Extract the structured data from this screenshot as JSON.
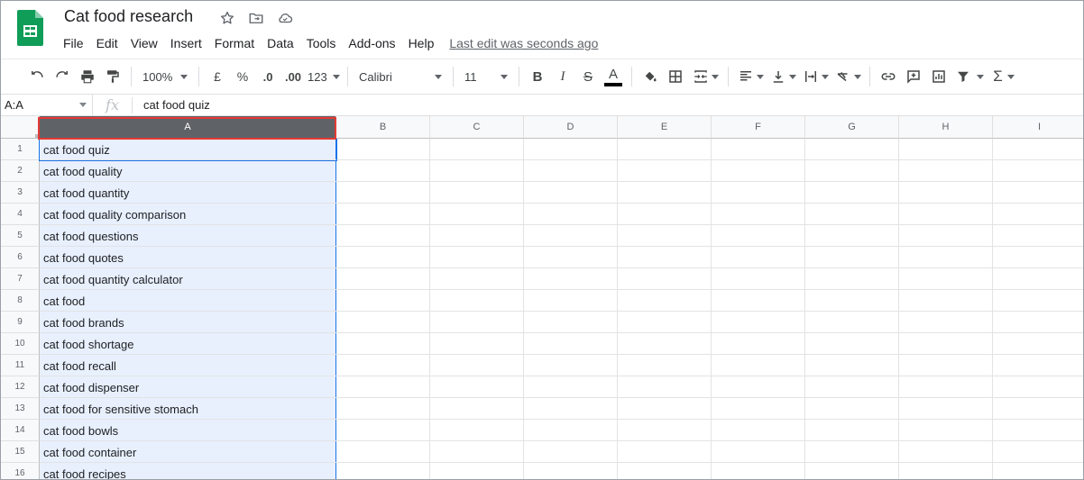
{
  "app": {
    "title": "Cat food research",
    "icons": [
      "sheets-logo-icon",
      "star-icon",
      "move-folder-icon",
      "cloud-status-icon"
    ],
    "brand_color": "#0f9d58"
  },
  "menu": {
    "items": [
      "File",
      "Edit",
      "View",
      "Insert",
      "Format",
      "Data",
      "Tools",
      "Add-ons",
      "Help"
    ],
    "last_edit": "Last edit was seconds ago"
  },
  "toolbar": {
    "zoom": "100%",
    "currency": "£",
    "percent": "%",
    "decrease_decimal": ".0",
    "increase_decimal": ".00",
    "format_more": "123",
    "font": "Calibri",
    "font_size": "11",
    "bold": "B",
    "italic": "I",
    "strikethrough": "S",
    "text_color_label": "A",
    "sum": "Σ"
  },
  "formula_bar": {
    "name_box": "A:A",
    "fx": "fx",
    "value": "cat food quiz"
  },
  "grid": {
    "columns": [
      "A",
      "B",
      "C",
      "D",
      "E",
      "F",
      "G",
      "H",
      "I"
    ],
    "selected_column": "A",
    "selection_color": "#e8f0fe",
    "highlight_color": "#e53935",
    "rows": [
      {
        "num": "1",
        "a": "cat food quiz"
      },
      {
        "num": "2",
        "a": "cat food quality"
      },
      {
        "num": "3",
        "a": "cat food quantity"
      },
      {
        "num": "4",
        "a": "cat food quality comparison"
      },
      {
        "num": "5",
        "a": "cat food questions"
      },
      {
        "num": "6",
        "a": "cat food quotes"
      },
      {
        "num": "7",
        "a": "cat food quantity calculator"
      },
      {
        "num": "8",
        "a": "cat food"
      },
      {
        "num": "9",
        "a": "cat food brands"
      },
      {
        "num": "10",
        "a": "cat food shortage"
      },
      {
        "num": "11",
        "a": "cat food recall"
      },
      {
        "num": "12",
        "a": "cat food dispenser"
      },
      {
        "num": "13",
        "a": "cat food for sensitive stomach"
      },
      {
        "num": "14",
        "a": "cat food bowls"
      },
      {
        "num": "15",
        "a": "cat food container"
      },
      {
        "num": "16",
        "a": "cat food recipes"
      }
    ]
  }
}
